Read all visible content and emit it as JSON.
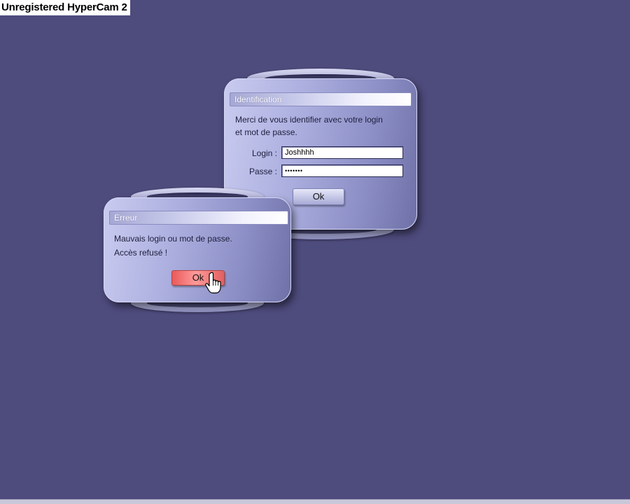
{
  "watermark": "Unregistered HyperCam 2",
  "identification": {
    "title": "Identification",
    "message_line1": "Merci de vous identifier avec votre login",
    "message_line2": "et mot de passe.",
    "login_label": "Login :",
    "login_value": "Joshhhh",
    "password_label": "Passe :",
    "password_value": "•••••••",
    "ok_label": "Ok"
  },
  "error": {
    "title": "Erreur",
    "message_line1": "Mauvais login ou mot de passe.",
    "message_line2": "Accès refusé !",
    "ok_label": "Ok"
  },
  "icons": {
    "cursor": "hand-pointer-icon"
  },
  "colors": {
    "desktop": "#4e4b7d",
    "panel": "#aeb1e0",
    "error_button": "#e85a5a"
  }
}
